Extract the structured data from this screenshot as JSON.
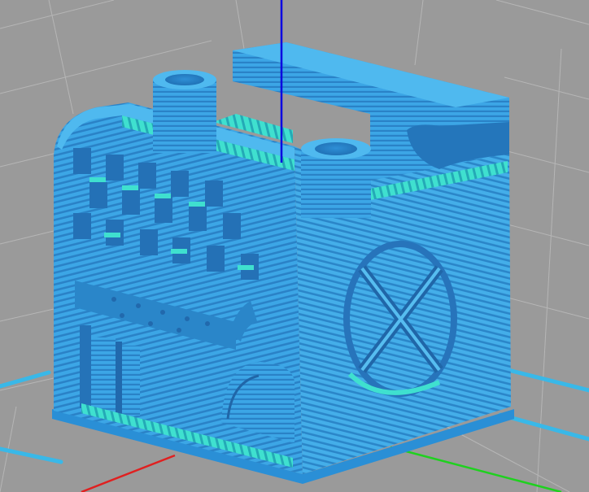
{
  "viewport": {
    "background": "#9a9a9a",
    "grid_line_color": "#b6b6b6",
    "bed_edge_color": "#39b8e8",
    "axes": {
      "x_color": "#e02020",
      "y_color": "#1fd11f",
      "z_color": "#0a00e0"
    }
  },
  "model": {
    "icon": "calibration-cube-icon",
    "layer_color": "#3ca6e6",
    "layer_dark": "#2a82c7",
    "shadow_color": "#2270b5",
    "infill_color": "#3fe0cf"
  }
}
